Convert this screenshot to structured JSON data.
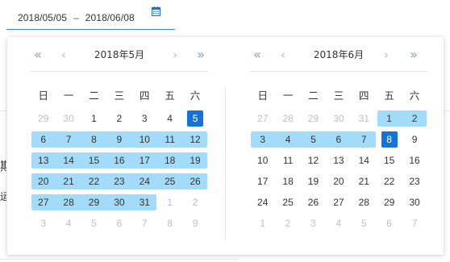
{
  "range_input": {
    "start": "2018/05/05",
    "separator": "–",
    "end": "2018/06/08",
    "icon": "calendar-icon"
  },
  "background": {
    "char_1": "期",
    "char_2": "运"
  },
  "left_calendar": {
    "title": "2018年5月",
    "nav": {
      "prev_year": "«",
      "prev_month": "‹",
      "next_month": "›",
      "next_year": "»"
    },
    "weekdays": [
      "日",
      "一",
      "二",
      "三",
      "四",
      "五",
      "六"
    ],
    "weeks": [
      [
        {
          "d": "29",
          "m": true
        },
        {
          "d": "30",
          "m": true
        },
        {
          "d": "1"
        },
        {
          "d": "2"
        },
        {
          "d": "3"
        },
        {
          "d": "4"
        },
        {
          "d": "5",
          "sel": true
        }
      ],
      [
        {
          "d": "6",
          "r": true
        },
        {
          "d": "7",
          "r": true
        },
        {
          "d": "8",
          "r": true
        },
        {
          "d": "9",
          "r": true
        },
        {
          "d": "10",
          "r": true
        },
        {
          "d": "11",
          "r": true
        },
        {
          "d": "12",
          "r": true
        }
      ],
      [
        {
          "d": "13",
          "r": true
        },
        {
          "d": "14",
          "r": true
        },
        {
          "d": "15",
          "r": true
        },
        {
          "d": "16",
          "r": true
        },
        {
          "d": "17",
          "r": true
        },
        {
          "d": "18",
          "r": true
        },
        {
          "d": "19",
          "r": true
        }
      ],
      [
        {
          "d": "20",
          "r": true
        },
        {
          "d": "21",
          "r": true
        },
        {
          "d": "22",
          "r": true
        },
        {
          "d": "23",
          "r": true
        },
        {
          "d": "24",
          "r": true
        },
        {
          "d": "25",
          "r": true
        },
        {
          "d": "26",
          "r": true
        }
      ],
      [
        {
          "d": "27",
          "r": true
        },
        {
          "d": "28",
          "r": true
        },
        {
          "d": "29",
          "r": true
        },
        {
          "d": "30",
          "r": true
        },
        {
          "d": "31",
          "r": true
        },
        {
          "d": "1",
          "m": true
        },
        {
          "d": "2",
          "m": true
        }
      ],
      [
        {
          "d": "3",
          "m": true
        },
        {
          "d": "4",
          "m": true
        },
        {
          "d": "5",
          "m": true
        },
        {
          "d": "6",
          "m": true
        },
        {
          "d": "7",
          "m": true
        },
        {
          "d": "8",
          "m": true
        },
        {
          "d": "9",
          "m": true
        }
      ]
    ]
  },
  "right_calendar": {
    "title": "2018年6月",
    "nav": {
      "prev_year": "«",
      "prev_month": "‹",
      "next_month": "›",
      "next_year": "»"
    },
    "weekdays": [
      "日",
      "一",
      "二",
      "三",
      "四",
      "五",
      "六"
    ],
    "weeks": [
      [
        {
          "d": "27",
          "m": true
        },
        {
          "d": "28",
          "m": true
        },
        {
          "d": "29",
          "m": true
        },
        {
          "d": "30",
          "m": true
        },
        {
          "d": "31",
          "m": true
        },
        {
          "d": "1",
          "r": true
        },
        {
          "d": "2",
          "r": true
        }
      ],
      [
        {
          "d": "3",
          "r": true
        },
        {
          "d": "4",
          "r": true
        },
        {
          "d": "5",
          "r": true
        },
        {
          "d": "6",
          "r": true
        },
        {
          "d": "7",
          "r": true
        },
        {
          "d": "8",
          "sel": true
        },
        {
          "d": "9"
        }
      ],
      [
        {
          "d": "10"
        },
        {
          "d": "11"
        },
        {
          "d": "12"
        },
        {
          "d": "13"
        },
        {
          "d": "14"
        },
        {
          "d": "15"
        },
        {
          "d": "16"
        }
      ],
      [
        {
          "d": "17"
        },
        {
          "d": "18"
        },
        {
          "d": "19"
        },
        {
          "d": "20"
        },
        {
          "d": "21"
        },
        {
          "d": "22"
        },
        {
          "d": "23"
        }
      ],
      [
        {
          "d": "24"
        },
        {
          "d": "25"
        },
        {
          "d": "26"
        },
        {
          "d": "27"
        },
        {
          "d": "28"
        },
        {
          "d": "29"
        },
        {
          "d": "30"
        }
      ],
      [
        {
          "d": "1",
          "m": true
        },
        {
          "d": "2",
          "m": true
        },
        {
          "d": "3",
          "m": true
        },
        {
          "d": "4",
          "m": true
        },
        {
          "d": "5",
          "m": true
        },
        {
          "d": "6",
          "m": true
        },
        {
          "d": "7",
          "m": true
        }
      ]
    ]
  },
  "colors": {
    "accent": "#1573d6",
    "range": "#a3dcfa",
    "input_underline": "#3b8ed9",
    "muted_text": "#bfbfbf",
    "nav_icon": "#8a9cb3"
  }
}
